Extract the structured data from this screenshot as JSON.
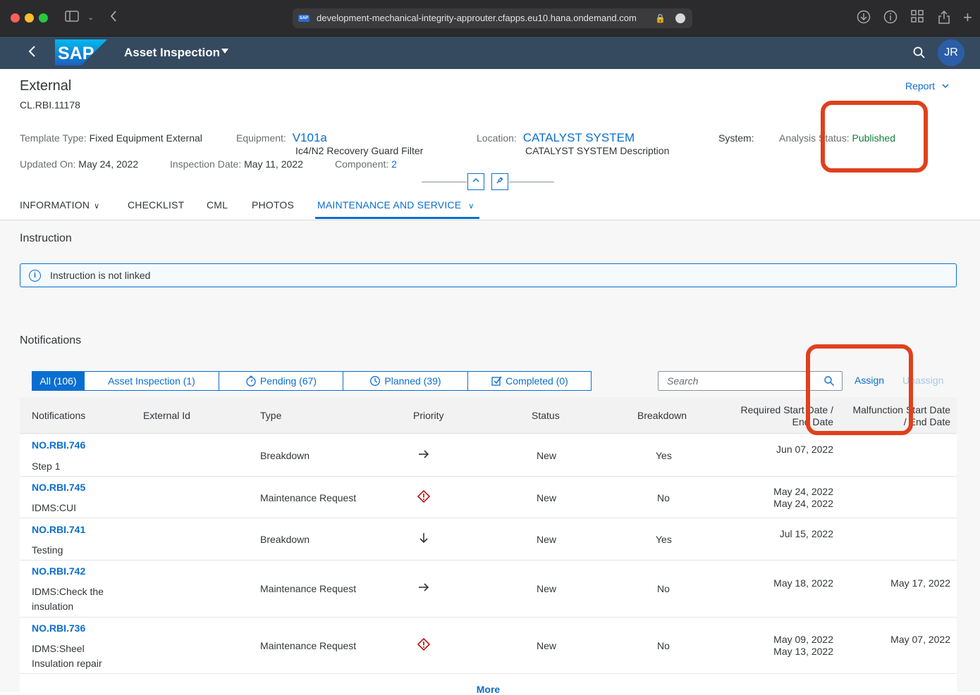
{
  "browser": {
    "url": "development-mechanical-integrity-approuter.cfapps.eu10.hana.ondemand.com",
    "favicon_text": "SAP"
  },
  "shell": {
    "logo": "SAP",
    "app_title": "Asset Inspection",
    "avatar_initials": "JR"
  },
  "header": {
    "title": "External",
    "subtitle": "CL.RBI.11178",
    "report_label": "Report",
    "template_type_label": "Template Type:",
    "template_type_value": "Fixed Equipment External",
    "equipment_label": "Equipment:",
    "equipment_value": "V101a",
    "equipment_desc": "Ic4/N2 Recovery Guard Filter",
    "location_label": "Location:",
    "location_value": "CATALYST SYSTEM",
    "location_desc": "CATALYST SYSTEM Description",
    "system_label": "System:",
    "analysis_status_label": "Analysis Status:",
    "analysis_status_value": "Published",
    "updated_on_label": "Updated On:",
    "updated_on_value": "May 24, 2022",
    "inspection_date_label": "Inspection Date:",
    "inspection_date_value": "May 11, 2022",
    "component_label": "Component:",
    "component_value": "2"
  },
  "tabs": [
    {
      "label": "INFORMATION",
      "has_menu": true
    },
    {
      "label": "CHECKLIST",
      "has_menu": false
    },
    {
      "label": "CML",
      "has_menu": false
    },
    {
      "label": "PHOTOS",
      "has_menu": false
    },
    {
      "label": "MAINTENANCE AND SERVICE",
      "has_menu": true,
      "active": true
    }
  ],
  "instruction": {
    "title": "Instruction",
    "message": "Instruction is not linked"
  },
  "notifications": {
    "title": "Notifications",
    "filters": [
      {
        "label": "All (106)",
        "active": true
      },
      {
        "label": "Asset Inspection (1)",
        "icon": ""
      },
      {
        "label": "Pending (67)",
        "icon": "stopwatch-icon"
      },
      {
        "label": "Planned (39)",
        "icon": "clock-icon"
      },
      {
        "label": "Completed (0)",
        "icon": "checkbox-icon"
      }
    ],
    "search_placeholder": "Search",
    "assign_label": "Assign",
    "unassign_label": "Unassign",
    "columns": {
      "notifications": "Notifications",
      "external_id": "External Id",
      "type": "Type",
      "priority": "Priority",
      "status": "Status",
      "breakdown": "Breakdown",
      "required_dates_1": "Required Start Date /",
      "required_dates_2": "End Date",
      "malfunction_dates_1": "Malfunction Start Date",
      "malfunction_dates_2": "/ End Date"
    },
    "rows": [
      {
        "id": "NO.RBI.746",
        "desc1": "Step 1",
        "desc2": "",
        "external_id": "",
        "type": "Breakdown",
        "priority": "arrow-right-icon",
        "status": "New",
        "breakdown": "Yes",
        "req_start": "Jun 07, 2022",
        "req_end": "",
        "mal_start": "",
        "mal_end": ""
      },
      {
        "id": "NO.RBI.745",
        "desc1": "IDMS:CUI",
        "desc2": "",
        "external_id": "",
        "type": "Maintenance Request",
        "priority": "high-priority-icon",
        "status": "New",
        "breakdown": "No",
        "req_start": "May 24, 2022",
        "req_end": "May 24, 2022",
        "mal_start": "",
        "mal_end": ""
      },
      {
        "id": "NO.RBI.741",
        "desc1": "Testing",
        "desc2": "",
        "external_id": "",
        "type": "Breakdown",
        "priority": "arrow-down-icon",
        "status": "New",
        "breakdown": "Yes",
        "req_start": "Jul 15, 2022",
        "req_end": "",
        "mal_start": "",
        "mal_end": ""
      },
      {
        "id": "NO.RBI.742",
        "desc1": "IDMS:Check the",
        "desc2": "insulation",
        "external_id": "",
        "type": "Maintenance Request",
        "priority": "arrow-right-icon",
        "status": "New",
        "breakdown": "No",
        "req_start": "May 18, 2022",
        "req_end": "",
        "mal_start": "May 17, 2022",
        "mal_end": ""
      },
      {
        "id": "NO.RBI.736",
        "desc1": "IDMS:Sheel",
        "desc2": "Insulation repair",
        "external_id": "",
        "type": "Maintenance Request",
        "priority": "high-priority-icon",
        "status": "New",
        "breakdown": "No",
        "req_start": "May 09, 2022",
        "req_end": "May 13, 2022",
        "mal_start": "May 07, 2022",
        "mal_end": ""
      }
    ],
    "more_label": "More"
  },
  "colors": {
    "shell_bg": "#354a5f",
    "accent": "#0a6ed1",
    "success": "#107e3e",
    "highlight": "#e0401c",
    "priority_high": "#bb0000"
  }
}
